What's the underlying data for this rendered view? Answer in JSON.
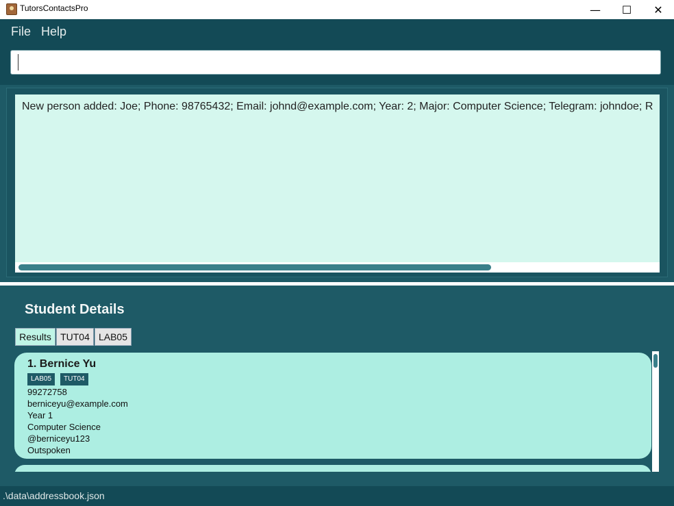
{
  "window": {
    "title": "TutorsContactsPro",
    "minimize": "—",
    "maximize": "☐",
    "close": "✕"
  },
  "menu": {
    "file": "File",
    "help": "Help"
  },
  "command": {
    "value": "",
    "placeholder": ""
  },
  "result": {
    "text": "New person added: Joe; Phone: 98765432; Email: johnd@example.com; Year: 2; Major: Computer Science; Telegram: johndoe; R"
  },
  "details": {
    "title": "Student Details",
    "tabs": [
      {
        "label": "Results",
        "active": true
      },
      {
        "label": "TUT04",
        "active": false
      },
      {
        "label": "LAB05",
        "active": false
      }
    ],
    "students": [
      {
        "index_name": "1.  Bernice Yu",
        "tags": [
          "LAB05",
          "TUT04"
        ],
        "phone": "99272758",
        "email": "berniceyu@example.com",
        "year": "Year 1",
        "major": "Computer Science",
        "telegram": "@berniceyu123",
        "remark": "Outspoken"
      }
    ]
  },
  "status": {
    "path": ".\\data\\addressbook.json"
  },
  "colors": {
    "dark_teal": "#134a56",
    "panel": "#1e5a66",
    "result_bg": "#d5f7ee",
    "card_bg": "#adeee2"
  }
}
